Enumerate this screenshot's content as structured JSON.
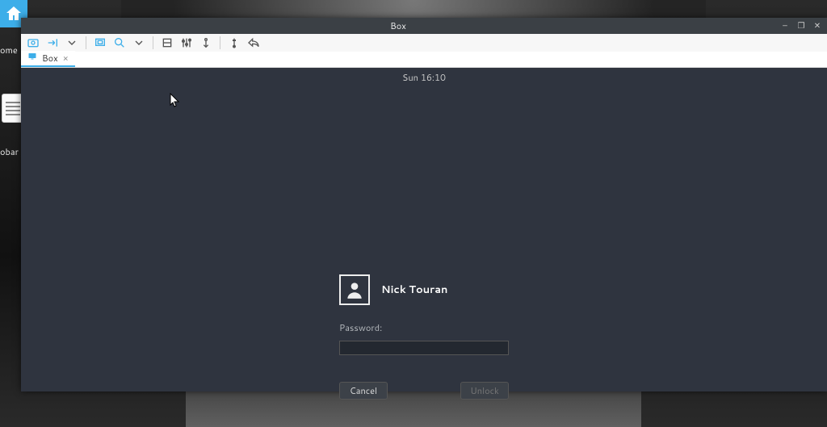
{
  "desktop": {
    "home_label": "ome",
    "doc_label": "obar b"
  },
  "window": {
    "title": "Box",
    "controls": {
      "min": "–",
      "max": "❐",
      "close": "✕"
    }
  },
  "toolbar_icons": [
    "screenshot-icon",
    "send-key-icon",
    "chevron-down-icon",
    "fullscreen-icon",
    "zoom-icon",
    "chevron-down-icon",
    "scale-icon",
    "settings-sliders-icon",
    "tune-icon",
    "usb-icon",
    "share-icon"
  ],
  "tab": {
    "label": "Box",
    "close": "×"
  },
  "vm": {
    "clock": "Sun 16:10",
    "user": "Nick Touran",
    "password_label": "Password:",
    "password_value": "",
    "cancel": "Cancel",
    "unlock": "Unlock"
  }
}
